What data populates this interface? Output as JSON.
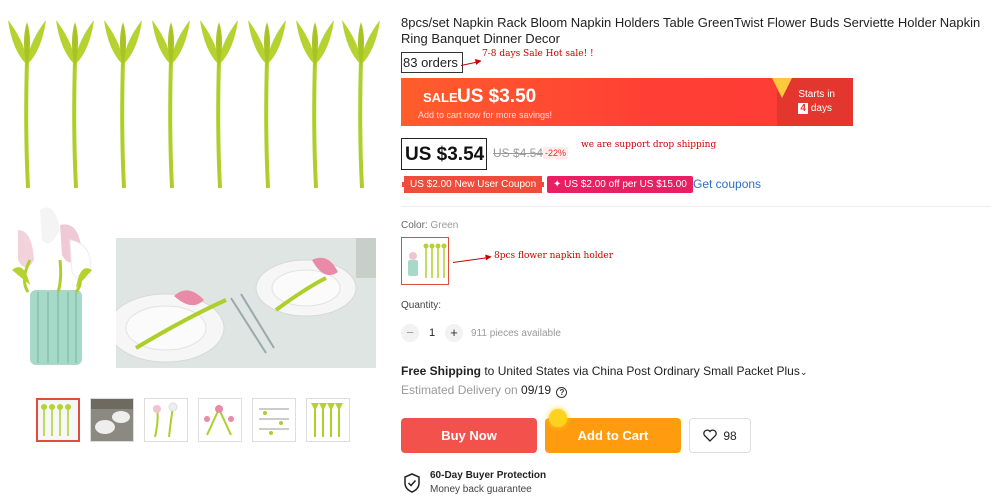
{
  "product": {
    "title": "8pcs/set Napkin Rack Bloom Napkin Holders Table GreenTwist Flower Buds Serviette Holder Napkin Ring Banquet Dinner Decor",
    "orders": "83 orders"
  },
  "annotations": {
    "sale_note": "7-8 days Sale Hot sale! !",
    "drop_note": "we are support drop shipping",
    "holder_note": "8pcs flower napkin holder"
  },
  "sale_banner": {
    "label": "SALE",
    "price": "US $3.50",
    "sub": "Add to cart now for more savings!",
    "starts_in": "Starts in",
    "days_count": "4",
    "days_word": "days"
  },
  "price": {
    "current": "US $3.54",
    "original": "US $4.54",
    "discount": "-22%"
  },
  "coupons": {
    "new_user": "US $2.00 New User Coupon",
    "spend": "✦ US $2.00 off per US $15.00",
    "get": "Get coupons"
  },
  "variant": {
    "label": "Color:",
    "value": "Green"
  },
  "quantity": {
    "label": "Quantity:",
    "value": "1",
    "minus": "−",
    "plus": "+",
    "available": "911 pieces available"
  },
  "shipping": {
    "free": "Free Shipping",
    "rest": " to United States via China Post Ordinary Small Packet Plus",
    "caret": "⌄",
    "estimated_label": "Estimated Delivery on ",
    "date": "09/19",
    "help": "?"
  },
  "actions": {
    "buy_now": "Buy Now",
    "add_to_cart": "Add to Cart",
    "wishlist_count": "98"
  },
  "protection": {
    "title": "60-Day Buyer Protection",
    "subtitle": "Money back guarantee"
  },
  "colors": {
    "stem": "#aecf2a",
    "sale": "#ff3f35",
    "buy": "#f2514c",
    "cart": "#ff9b0f",
    "link": "#2a6fc4"
  }
}
